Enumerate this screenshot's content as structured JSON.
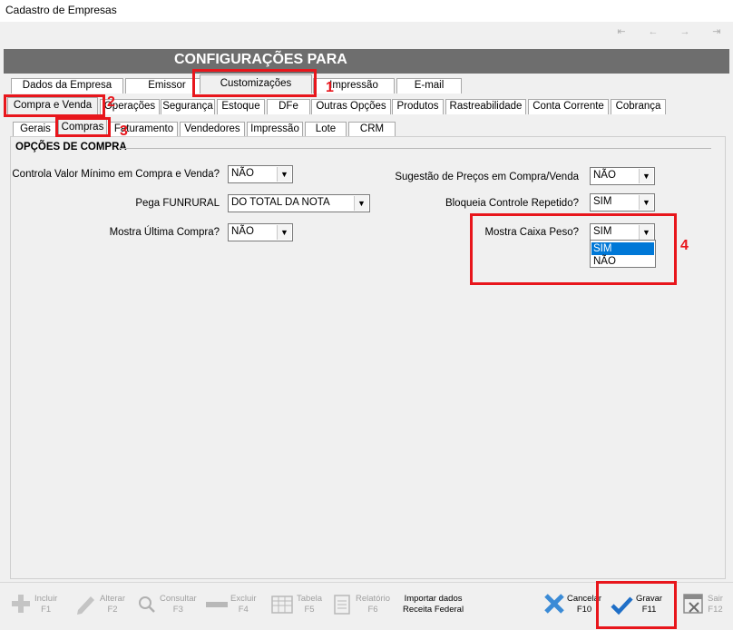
{
  "window": {
    "title": "Cadastro de Empresas"
  },
  "nav": {
    "first": "⇤",
    "prev": "←",
    "next": "→",
    "last": "⇥"
  },
  "header": {
    "title": "CONFIGURAÇÕES PARA"
  },
  "tabs_level1": [
    "Dados da Empresa",
    "Emissor",
    "Customizações",
    "Impressão",
    "E-mail"
  ],
  "tabs_level2": [
    "Compra e Venda",
    "Operações",
    "Segurança",
    "Estoque",
    "DFe",
    "Outras Opções",
    "Produtos",
    "Rastreabilidade",
    "Conta Corrente",
    "Cobrança"
  ],
  "tabs_level3": [
    "Gerais",
    "Compras",
    "Faturamento",
    "Vendedores",
    "Impressão",
    "Lote",
    "CRM"
  ],
  "section": {
    "title": "OPÇÕES DE COMPRA"
  },
  "fields": {
    "valor_minimo": {
      "label": "Controla Valor Mínimo em Compra e Venda?",
      "value": "NÃO"
    },
    "funrural": {
      "label": "Pega FUNRURAL",
      "value": "DO TOTAL DA NOTA"
    },
    "ultima_compra": {
      "label": "Mostra Última Compra?",
      "value": "NÃO"
    },
    "sugestao_precos": {
      "label": "Sugestão de Preços em Compra/Venda",
      "value": "NÃO"
    },
    "bloqueia_repetido": {
      "label": "Bloqueia Controle Repetido?",
      "value": "SIM"
    },
    "caixa_peso": {
      "label": "Mostra Caixa Peso?",
      "value": "SIM",
      "options": [
        "SIM",
        "NÃO"
      ]
    }
  },
  "annotations": [
    "1",
    "2",
    "3",
    "4"
  ],
  "toolbar": {
    "incluir": {
      "label": "Incluir",
      "key": "F1"
    },
    "alterar": {
      "label": "Alterar",
      "key": "F2"
    },
    "consultar": {
      "label": "Consultar",
      "key": "F3"
    },
    "excluir": {
      "label": "Excluir",
      "key": "F4"
    },
    "tabela": {
      "label": "Tabela",
      "key": "F5"
    },
    "relatorio": {
      "label": "Relatório",
      "key": "F6"
    },
    "importar": {
      "label": "Importar dados",
      "key": "Receita Federal"
    },
    "cancelar": {
      "label": "Cancelar",
      "key": "F10"
    },
    "gravar": {
      "label": "Gravar",
      "key": "F11"
    },
    "sair": {
      "label": "Sair",
      "key": "F12"
    }
  },
  "colors": {
    "accent": "#e8161c",
    "header": "#6e6e6e",
    "selection": "#0078d7"
  }
}
